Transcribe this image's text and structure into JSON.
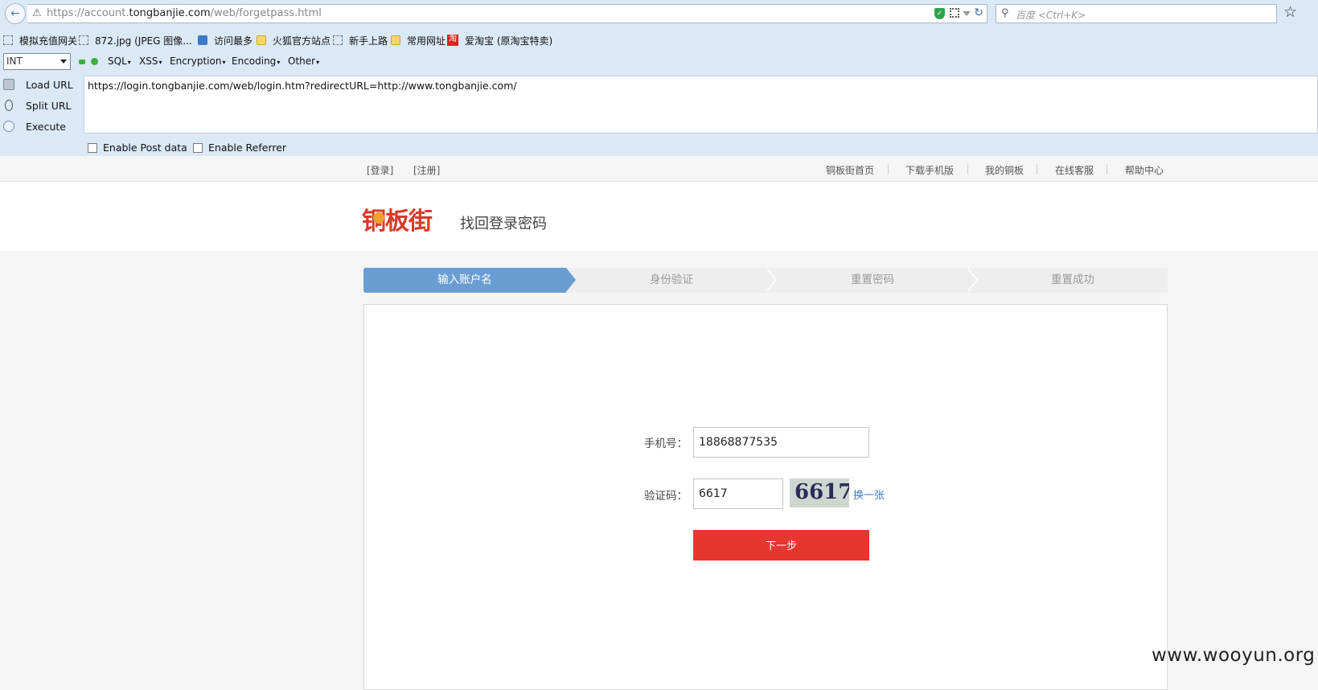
{
  "browser": {
    "url_prefix": "https://account.",
    "url_domain": "tongbanjie.com",
    "url_path": "/web/forgetpass.html",
    "search_placeholder": "百度 <Ctrl+K>"
  },
  "bookmarks": [
    {
      "label": "模拟充值网关",
      "icon": "dashed-page-icon"
    },
    {
      "label": "872.jpg (JPEG 图像...",
      "icon": "dashed-page-icon"
    },
    {
      "label": "访问最多",
      "icon": "globe-icon"
    },
    {
      "label": "火狐官方站点",
      "icon": "folder-icon"
    },
    {
      "label": "新手上路",
      "icon": "dashed-page-icon"
    },
    {
      "label": "常用网址",
      "icon": "folder-icon"
    },
    {
      "label": "爱淘宝 (原淘宝特卖)",
      "icon": "taobao-icon"
    }
  ],
  "hackbar": {
    "select_value": "INT",
    "menus": [
      "SQL",
      "XSS",
      "Encryption",
      "Encoding",
      "Other"
    ],
    "load_url": "Load URL",
    "split_url": "Split URL",
    "execute": "Execute",
    "url_value": "https://login.tongbanjie.com/web/login.htm?redirectURL=http://www.tongbanjie.com/",
    "enable_post": "Enable Post data",
    "enable_referrer": "Enable Referrer"
  },
  "topnav": {
    "login": "[登录]",
    "register": "[注册]",
    "links": [
      "铜板街首页",
      "下载手机版",
      "我的铜板",
      "在线客服",
      "帮助中心"
    ]
  },
  "header": {
    "logo": "铜板街",
    "subtitle": "找回登录密码"
  },
  "steps": [
    "输入账户名",
    "身份验证",
    "重置密码",
    "重置成功"
  ],
  "form": {
    "phone_label": "手机号：",
    "phone_value": "18868877535",
    "captcha_label": "验证码：",
    "captcha_value": "6617",
    "captcha_image_text": "6617",
    "refresh_link": "换一张",
    "next_button": "下一步"
  },
  "watermark": "www.wooyun.org",
  "colors": {
    "brand_red": "#e5362f",
    "step_active": "#6a9ed3",
    "link_blue": "#3a7bc8",
    "chrome_bg": "#dbe8f6"
  }
}
